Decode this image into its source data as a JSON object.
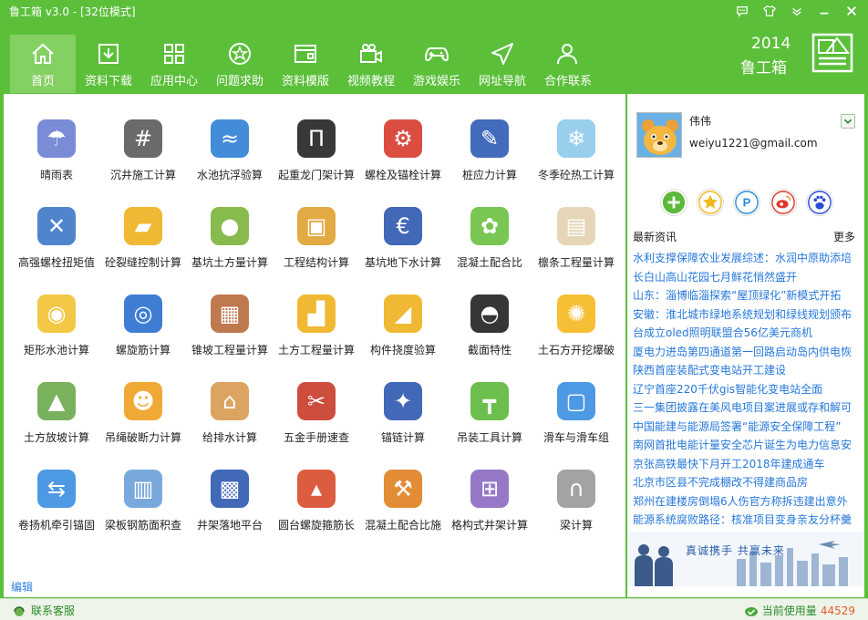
{
  "window": {
    "title": "鲁工箱 v3.0 - [32位模式]"
  },
  "nav": [
    {
      "label": "首页",
      "icon": "home-icon"
    },
    {
      "label": "资料下载",
      "icon": "download-icon"
    },
    {
      "label": "应用中心",
      "icon": "apps-icon"
    },
    {
      "label": "问题求助",
      "icon": "help-icon"
    },
    {
      "label": "资料模版",
      "icon": "template-icon"
    },
    {
      "label": "视频教程",
      "icon": "video-icon"
    },
    {
      "label": "游戏娱乐",
      "icon": "gamepad-icon"
    },
    {
      "label": "网址导航",
      "icon": "navigation-icon"
    },
    {
      "label": "合作联系",
      "icon": "contact-icon"
    }
  ],
  "brand": {
    "year": "2014",
    "name": "鲁工箱"
  },
  "tools": [
    {
      "label": "晴雨表",
      "icon": "weather-icon",
      "color": "#6a7fd0"
    },
    {
      "label": "沉井施工计算",
      "icon": "hash-icon",
      "color": "#5a5a5a"
    },
    {
      "label": "水池抗浮验算",
      "icon": "pool-icon",
      "color": "#2f7fd4"
    },
    {
      "label": "起重龙门架计算",
      "icon": "gantry-icon",
      "color": "#222222"
    },
    {
      "label": "螺栓及锚栓计算",
      "icon": "bolt-icon",
      "color": "#d83a2c"
    },
    {
      "label": "桩应力计算",
      "icon": "pile-icon",
      "color": "#2f5bb5"
    },
    {
      "label": "冬季砼热工计算",
      "icon": "snowflake-icon",
      "color": "#8ec9ea"
    },
    {
      "label": "高强螺栓扭矩值",
      "icon": "wrench-icon",
      "color": "#3d78c7"
    },
    {
      "label": "砼裂缝控制计算",
      "icon": "bulldozer-icon",
      "color": "#f0b01d"
    },
    {
      "label": "基坑土方量计算",
      "icon": "planet-icon",
      "color": "#7bb43a"
    },
    {
      "label": "工程结构计算",
      "icon": "toolbox-icon",
      "color": "#e0a030"
    },
    {
      "label": "基坑地下水计算",
      "icon": "euro-icon",
      "color": "#2e58b0"
    },
    {
      "label": "混凝土配合比",
      "icon": "flower-icon",
      "color": "#6cc040"
    },
    {
      "label": "檩条工程量计算",
      "icon": "scroll-icon",
      "color": "#e3d2b0"
    },
    {
      "label": "矩形水池计算",
      "icon": "globe-icon",
      "color": "#f2c232"
    },
    {
      "label": "螺旋筋计算",
      "icon": "spiral-icon",
      "color": "#2a6fd0"
    },
    {
      "label": "锥坡工程量计算",
      "icon": "building-icon",
      "color": "#b86a3c"
    },
    {
      "label": "土方工程量计算",
      "icon": "loader-icon",
      "color": "#f0b01d"
    },
    {
      "label": "构件挠度验算",
      "icon": "excavator-icon",
      "color": "#f0b01d"
    },
    {
      "label": "截面特性",
      "icon": "helmet-icon",
      "color": "#202020"
    },
    {
      "label": "土石方开挖爆破",
      "icon": "spark-icon",
      "color": "#f5b820"
    },
    {
      "label": "土方放坡计算",
      "icon": "landscape-icon",
      "color": "#6aa84a"
    },
    {
      "label": "吊绳破断力计算",
      "icon": "worker-icon",
      "color": "#f0a020"
    },
    {
      "label": "给排水计算",
      "icon": "house-icon",
      "color": "#d89a50"
    },
    {
      "label": "五金手册速查",
      "icon": "tools-icon",
      "color": "#c83a2a"
    },
    {
      "label": "锚链计算",
      "icon": "compass-icon",
      "color": "#2e58b0"
    },
    {
      "label": "吊装工具计算",
      "icon": "crane-icon",
      "color": "#5cb83a"
    },
    {
      "label": "滑车与滑车组",
      "icon": "device-icon",
      "color": "#3a8ee0"
    },
    {
      "label": "卷扬机牵引锚固",
      "icon": "winch-icon",
      "color": "#3a8ee0"
    },
    {
      "label": "梁板钢筋面积查",
      "icon": "table-icon",
      "color": "#6aa0d8"
    },
    {
      "label": "井架落地平台",
      "icon": "platform-icon",
      "color": "#2e58b0"
    },
    {
      "label": "圆台螺旋箍筋长",
      "icon": "cone-icon",
      "color": "#d84a2a"
    },
    {
      "label": "混凝土配合比施",
      "icon": "hammer-icon",
      "color": "#e08020"
    },
    {
      "label": "格构式井架计算",
      "icon": "lattice-icon",
      "color": "#8a6ac0"
    },
    {
      "label": "梁计算",
      "icon": "arch-icon",
      "color": "#999999"
    }
  ],
  "main": {
    "edit_label": "编辑"
  },
  "user": {
    "name": "伟伟",
    "email": "weiyu1221@gmail.com"
  },
  "social": [
    {
      "icon": "add-icon",
      "color": "#5cb83a"
    },
    {
      "icon": "star-icon",
      "color": "#f0b81d"
    },
    {
      "icon": "p-icon",
      "color": "#2a8ad8"
    },
    {
      "icon": "weibo-icon",
      "color": "#e0352a"
    },
    {
      "icon": "baidu-icon",
      "color": "#2a4ad8"
    }
  ],
  "news": {
    "title": "最新资讯",
    "more_label": "更多",
    "items": [
      "水利支撑保障农业发展综述：水润中原助添培",
      "长白山高山花园七月鲜花悄然盛开",
      "山东：淄博临淄探索“屋顶绿化”新模式开拓",
      "安徽：淮北城市绿地系统规划和绿线规划颁布",
      "台成立oled照明联盟合56亿美元商机",
      "厦电力进岛第四通道第一回路启动岛内供电恢",
      "陕西首座装配式变电站开工建设",
      "辽宁首座220千伏gis智能化变电站全面",
      "三一集团披露在美风电项目案进展或存和解可",
      "中国能建与能源局签署“能源安全保障工程”",
      "南网首批电能计量安全芯片诞生为电力信息安",
      "京张高铁最快下月开工2018年建成通车",
      "北京市区县不完成棚改不得建商品房",
      "郑州在建楼房倒塌6人伤官方称拆违建出意外",
      "能源系统腐败路径：核准项目变身亲友分杯羹"
    ]
  },
  "banner": {
    "slogan": "真诚携手  共赢未来"
  },
  "status": {
    "customer_service": "联系客服",
    "usage_label": "当前使用量",
    "usage_count": "44529"
  }
}
